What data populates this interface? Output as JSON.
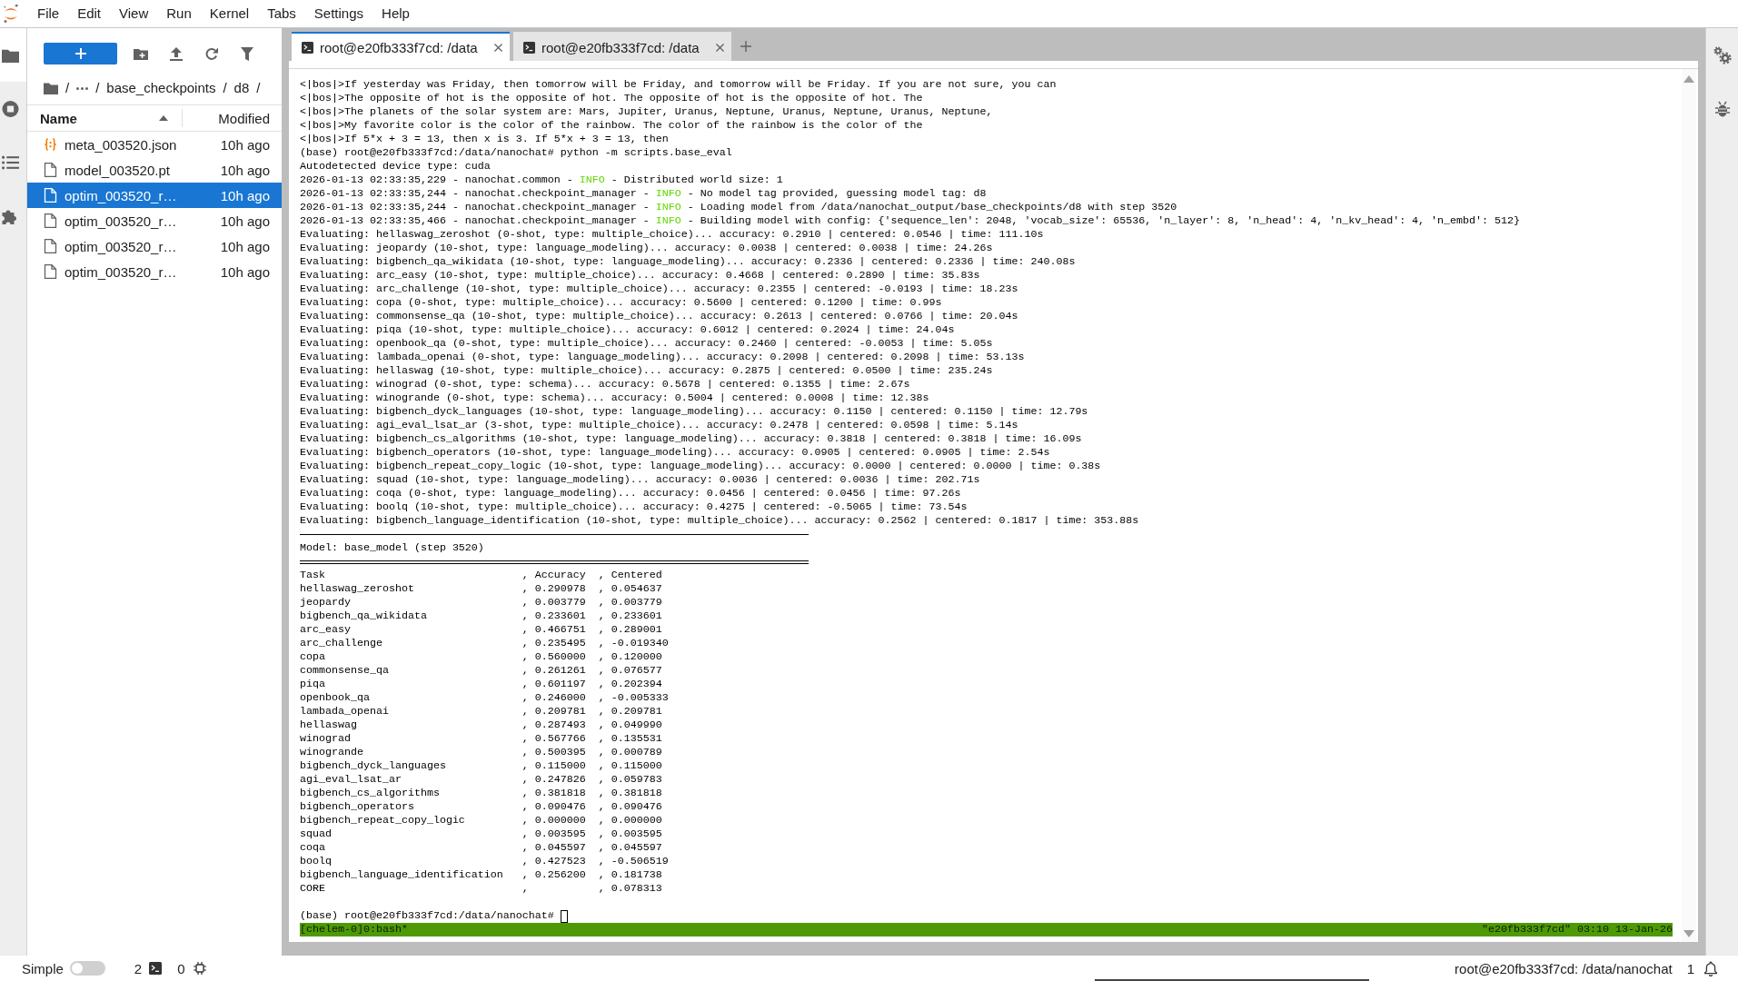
{
  "menu_bar": {
    "items": [
      "File",
      "Edit",
      "View",
      "Run",
      "Kernel",
      "Tabs",
      "Settings",
      "Help"
    ]
  },
  "left_sidebar": {
    "tabs": [
      {
        "kind": "files",
        "selected": true
      },
      {
        "kind": "running",
        "selected": false
      },
      {
        "kind": "toc",
        "selected": false
      },
      {
        "kind": "extensions",
        "selected": false
      }
    ]
  },
  "file_browser": {
    "breadcrumbs": [
      {
        "kind": "root"
      },
      {
        "kind": "separator",
        "text": "/"
      },
      {
        "kind": "ellipsis"
      },
      {
        "kind": "separator",
        "text": "/"
      },
      {
        "kind": "folder",
        "text": "base_checkpoints"
      },
      {
        "kind": "separator",
        "text": "/"
      },
      {
        "kind": "folder",
        "text": "d8"
      },
      {
        "kind": "separator",
        "text": "/"
      }
    ],
    "columns": [
      {
        "label": "Name",
        "sorted": true
      },
      {
        "label": "Modified"
      }
    ],
    "files": [
      {
        "kind": "json",
        "name": "meta_003520.json",
        "modified": "10h ago",
        "selected": false
      },
      {
        "kind": "file",
        "name": "model_003520.pt",
        "modified": "10h ago",
        "selected": false
      },
      {
        "kind": "file",
        "name": "optim_003520_r…",
        "modified": "10h ago",
        "selected": true
      },
      {
        "kind": "file",
        "name": "optim_003520_r…",
        "modified": "10h ago",
        "selected": false
      },
      {
        "kind": "file",
        "name": "optim_003520_r…",
        "modified": "10h ago",
        "selected": false
      },
      {
        "kind": "file",
        "name": "optim_003520_r…",
        "modified": "10h ago",
        "selected": false
      }
    ]
  },
  "main_area": {
    "tabs": [
      {
        "label": "root@e20fb333f7cd: /data",
        "selected": true
      },
      {
        "label": "root@e20fb333f7cd: /data",
        "selected": false
      }
    ],
    "terminal": {
      "lines": [
        {
          "kind": "text",
          "text": "<|bos|>If yesterday was Friday, then tomorrow will be Friday, and tomorrow will be Friday. If you are not sure, you can"
        },
        {
          "kind": "text",
          "text": "<|bos|>The opposite of hot is the opposite of hot. The opposite of hot is the opposite of hot. The"
        },
        {
          "kind": "text",
          "text": "<|bos|>The planets of the solar system are: Mars, Jupiter, Uranus, Neptune, Uranus, Neptune, Uranus, Neptune,"
        },
        {
          "kind": "text",
          "text": "<|bos|>My favorite color is the color of the rainbow. The color of the rainbow is the color of the"
        },
        {
          "kind": "text",
          "text": "<|bos|>If 5*x + 3 = 13, then x is 3. If 5*x + 3 = 13, then"
        },
        {
          "kind": "text",
          "text": "(base) root@e20fb333f7cd:/data/nanochat# python -m scripts.base_eval"
        },
        {
          "kind": "text",
          "text": "Autodetected device type: cuda"
        },
        {
          "kind": "info_log",
          "before": "2026-01-13 02:33:35,229 - nanochat.common - ",
          "severity": "INFO",
          "after": " - Distributed world size: 1"
        },
        {
          "kind": "info_log",
          "before": "2026-01-13 02:33:35,244 - nanochat.checkpoint_manager - ",
          "severity": "INFO",
          "after": " - No model tag provided, guessing model tag: d8"
        },
        {
          "kind": "info_log",
          "before": "2026-01-13 02:33:35,244 - nanochat.checkpoint_manager - ",
          "severity": "INFO",
          "after": " - Loading model from /data/nanochat_output/base_checkpoints/d8 with step 3520"
        },
        {
          "kind": "info_log",
          "before": "2026-01-13 02:33:35,466 - nanochat.checkpoint_manager - ",
          "severity": "INFO",
          "after": " - Building model with config: {'sequence_len': 2048, 'vocab_size': 65536, 'n_layer': 8, 'n_head': 4, 'n_kv_head': 4, 'n_embd': 512}"
        },
        {
          "kind": "text",
          "text": "Evaluating: hellaswag_zeroshot (0-shot, type: multiple_choice)... accuracy: 0.2910 | centered: 0.0546 | time: 111.10s"
        },
        {
          "kind": "text",
          "text": "Evaluating: jeopardy (10-shot, type: language_modeling)... accuracy: 0.0038 | centered: 0.0038 | time: 24.26s"
        },
        {
          "kind": "text",
          "text": "Evaluating: bigbench_qa_wikidata (10-shot, type: language_modeling)... accuracy: 0.2336 | centered: 0.2336 | time: 240.08s"
        },
        {
          "kind": "text",
          "text": "Evaluating: arc_easy (10-shot, type: multiple_choice)... accuracy: 0.4668 | centered: 0.2890 | time: 35.83s"
        },
        {
          "kind": "text",
          "text": "Evaluating: arc_challenge (10-shot, type: multiple_choice)... accuracy: 0.2355 | centered: -0.0193 | time: 18.23s"
        },
        {
          "kind": "text",
          "text": "Evaluating: copa (0-shot, type: multiple_choice)... accuracy: 0.5600 | centered: 0.1200 | time: 0.99s"
        },
        {
          "kind": "text",
          "text": "Evaluating: commonsense_qa (10-shot, type: multiple_choice)... accuracy: 0.2613 | centered: 0.0766 | time: 20.04s"
        },
        {
          "kind": "text",
          "text": "Evaluating: piqa (10-shot, type: multiple_choice)... accuracy: 0.6012 | centered: 0.2024 | time: 24.04s"
        },
        {
          "kind": "text",
          "text": "Evaluating: openbook_qa (0-shot, type: multiple_choice)... accuracy: 0.2460 | centered: -0.0053 | time: 5.05s"
        },
        {
          "kind": "text",
          "text": "Evaluating: lambada_openai (0-shot, type: language_modeling)... accuracy: 0.2098 | centered: 0.2098 | time: 53.13s"
        },
        {
          "kind": "text",
          "text": "Evaluating: hellaswag (10-shot, type: multiple_choice)... accuracy: 0.2875 | centered: 0.0500 | time: 235.24s"
        },
        {
          "kind": "text",
          "text": "Evaluating: winograd (0-shot, type: schema)... accuracy: 0.5678 | centered: 0.1355 | time: 2.67s"
        },
        {
          "kind": "text",
          "text": "Evaluating: winogrande (0-shot, type: schema)... accuracy: 0.5004 | centered: 0.0008 | time: 12.38s"
        },
        {
          "kind": "text",
          "text": "Evaluating: bigbench_dyck_languages (10-shot, type: language_modeling)... accuracy: 0.1150 | centered: 0.1150 | time: 12.79s"
        },
        {
          "kind": "text",
          "text": "Evaluating: agi_eval_lsat_ar (3-shot, type: multiple_choice)... accuracy: 0.2478 | centered: 0.0598 | time: 5.14s"
        },
        {
          "kind": "text",
          "text": "Evaluating: bigbench_cs_algorithms (10-shot, type: language_modeling)... accuracy: 0.3818 | centered: 0.3818 | time: 16.09s"
        },
        {
          "kind": "text",
          "text": "Evaluating: bigbench_operators (10-shot, type: language_modeling)... accuracy: 0.0905 | centered: 0.0905 | time: 2.54s"
        },
        {
          "kind": "text",
          "text": "Evaluating: bigbench_repeat_copy_logic (10-shot, type: language_modeling)... accuracy: 0.0000 | centered: 0.0000 | time: 0.38s"
        },
        {
          "kind": "text",
          "text": "Evaluating: squad (10-shot, type: language_modeling)... accuracy: 0.0036 | centered: 0.0036 | time: 202.71s"
        },
        {
          "kind": "text",
          "text": "Evaluating: coqa (0-shot, type: language_modeling)... accuracy: 0.0456 | centered: 0.0456 | time: 97.26s"
        },
        {
          "kind": "text",
          "text": "Evaluating: boolq (10-shot, type: multiple_choice)... accuracy: 0.4275 | centered: -0.5065 | time: 73.54s"
        },
        {
          "kind": "text",
          "text": "Evaluating: bigbench_language_identification (10-shot, type: multiple_choice)... accuracy: 0.2562 | centered: 0.1817 | time: 353.88s"
        },
        {
          "kind": "single_rule"
        },
        {
          "kind": "text",
          "text": "Model: base_model (step 3520)"
        },
        {
          "kind": "double_rule"
        },
        {
          "kind": "text",
          "text": "Task                               , Accuracy  , Centered"
        },
        {
          "kind": "text",
          "text": "hellaswag_zeroshot                 , 0.290978  , 0.054637"
        },
        {
          "kind": "text",
          "text": "jeopardy                           , 0.003779  , 0.003779"
        },
        {
          "kind": "text",
          "text": "bigbench_qa_wikidata               , 0.233601  , 0.233601"
        },
        {
          "kind": "text",
          "text": "arc_easy                           , 0.466751  , 0.289001"
        },
        {
          "kind": "text",
          "text": "arc_challenge                      , 0.235495  , -0.019340"
        },
        {
          "kind": "text",
          "text": "copa                               , 0.560000  , 0.120000"
        },
        {
          "kind": "text",
          "text": "commonsense_qa                     , 0.261261  , 0.076577"
        },
        {
          "kind": "text",
          "text": "piqa                               , 0.601197  , 0.202394"
        },
        {
          "kind": "text",
          "text": "openbook_qa                        , 0.246000  , -0.005333"
        },
        {
          "kind": "text",
          "text": "lambada_openai                     , 0.209781  , 0.209781"
        },
        {
          "kind": "text",
          "text": "hellaswag                          , 0.287493  , 0.049990"
        },
        {
          "kind": "text",
          "text": "winograd                           , 0.567766  , 0.135531"
        },
        {
          "kind": "text",
          "text": "winogrande                         , 0.500395  , 0.000789"
        },
        {
          "kind": "text",
          "text": "bigbench_dyck_languages            , 0.115000  , 0.115000"
        },
        {
          "kind": "text",
          "text": "agi_eval_lsat_ar                   , 0.247826  , 0.059783"
        },
        {
          "kind": "text",
          "text": "bigbench_cs_algorithms             , 0.381818  , 0.381818"
        },
        {
          "kind": "text",
          "text": "bigbench_operators                 , 0.090476  , 0.090476"
        },
        {
          "kind": "text",
          "text": "bigbench_repeat_copy_logic         , 0.000000  , 0.000000"
        },
        {
          "kind": "text",
          "text": "squad                              , 0.003595  , 0.003595"
        },
        {
          "kind": "text",
          "text": "coqa                               , 0.045597  , 0.045597"
        },
        {
          "kind": "text",
          "text": "boolq                              , 0.427523  , -0.506519"
        },
        {
          "kind": "text",
          "text": "bigbench_language_identification   , 0.256200  , 0.181738"
        },
        {
          "kind": "text",
          "text": "CORE                               ,           , 0.078313"
        }
      ],
      "prompt": {
        "text": "(base) root@e20fb333f7cd:/data/nanochat#",
        "cursor": true
      },
      "status_line": {
        "left": "[chelem-0]0:bash*",
        "right": "\"e20fb333f7cd\" 03:10 13-Jan-26"
      }
    }
  },
  "right_sidebar": {
    "tabs": [
      {
        "kind": "property_inspector",
        "selected": false
      },
      {
        "kind": "debugger",
        "selected": false
      }
    ]
  },
  "status_bar": {
    "simple_mode": {
      "label": "Simple",
      "on": false
    },
    "terminals": "2",
    "kernels": "0",
    "path": "root@e20fb333f7cd: /data/nanochat",
    "notifications": "1"
  }
}
